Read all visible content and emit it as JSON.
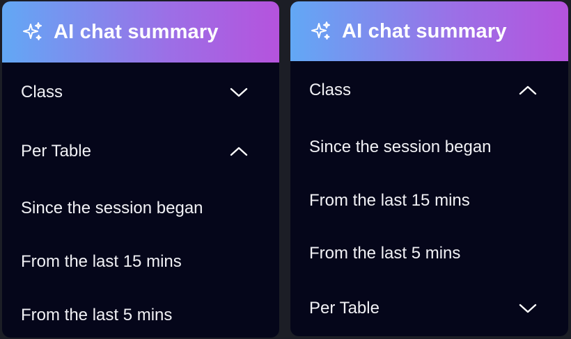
{
  "left_panel": {
    "header": {
      "icon": "sparkles-icon",
      "title": "AI chat summary"
    },
    "class_label": "Class",
    "class_chevron": "chevron-down-icon",
    "per_table_label": "Per Table",
    "per_table_chevron": "chevron-up-icon",
    "options": [
      "Since the session began",
      "From the last 15 mins",
      "From the last 5 mins"
    ]
  },
  "right_panel": {
    "header": {
      "icon": "sparkles-icon",
      "title": "AI chat summary"
    },
    "class_label": "Class",
    "class_chevron": "chevron-up-icon",
    "options": [
      "Since the session began",
      "From the last 15 mins",
      "From the last 5 mins"
    ],
    "per_table_label": "Per Table",
    "per_table_chevron": "chevron-down-icon"
  },
  "colors": {
    "panel_bg": "#05061a",
    "header_gradient_start": "#62a8f5",
    "header_gradient_end": "#b553dd",
    "text": "#f1f1f5"
  }
}
